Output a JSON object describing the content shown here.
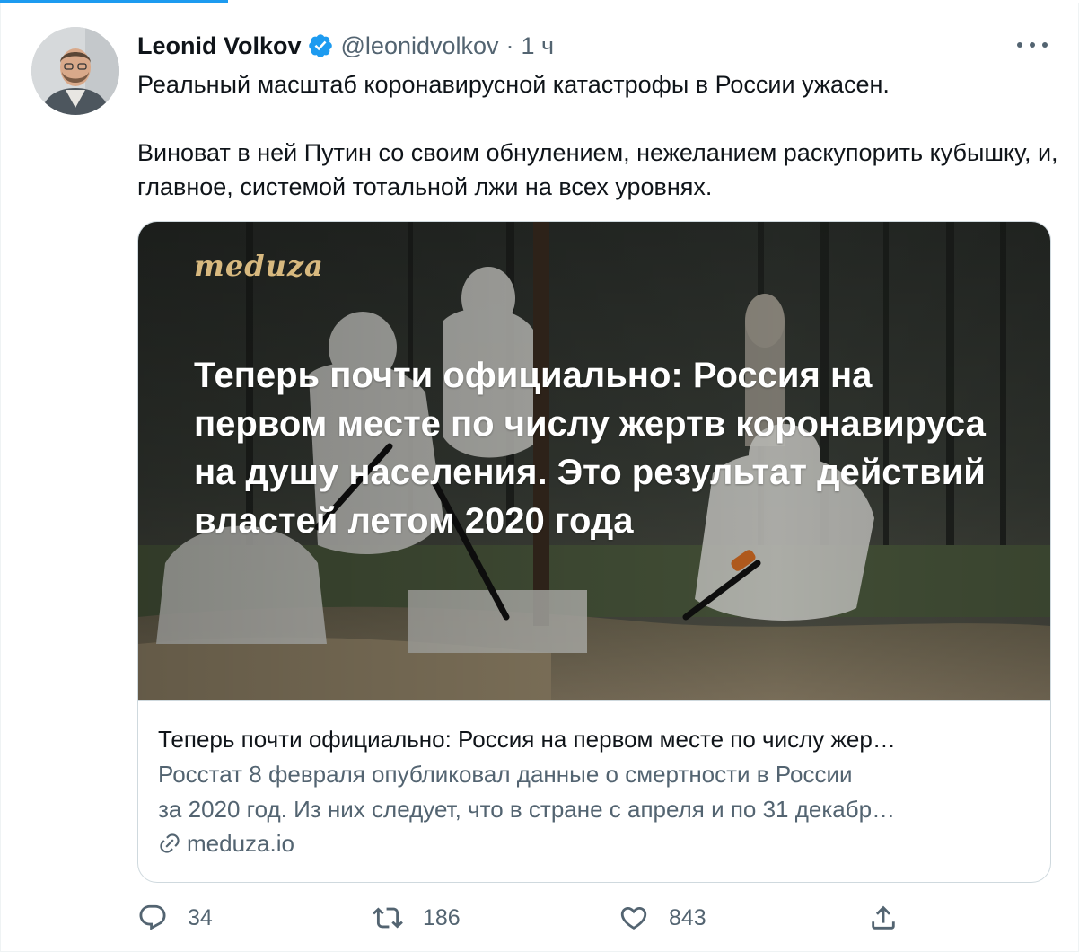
{
  "tweet": {
    "author_name": "Leonid Volkov",
    "handle": "@leonidvolkov",
    "separator": "·",
    "time": "1 ч",
    "text_line1": "Реальный масштаб коронавирусной катастрофы в России ужасен.",
    "text_line2": "Виноват в ней Путин со своим обнулением, нежеланием раскупорить кубышку, и, главное, системой тотальной лжи на всех уровнях."
  },
  "card": {
    "brand": "meduza",
    "image_headline": "Теперь почти официально: Россия на первом месте по числу жертв коронавируса на душу населения. Это результат действий властей летом 2020 года",
    "title": "Теперь почти официально: Россия на первом месте по числу жер…",
    "desc_line1": "Росстат 8 февраля опубликовал данные о смертности в России",
    "desc_line2": "за 2020 год. Из них следует, что в стране с апреля и по 31 декабр…",
    "domain": "meduza.io"
  },
  "actions": {
    "replies": "34",
    "retweets": "186",
    "likes": "843"
  },
  "colors": {
    "accent": "#1d9bf0",
    "secondary_text": "#536471",
    "border": "#cfd9de",
    "brand_gold": "#d8b97f"
  }
}
